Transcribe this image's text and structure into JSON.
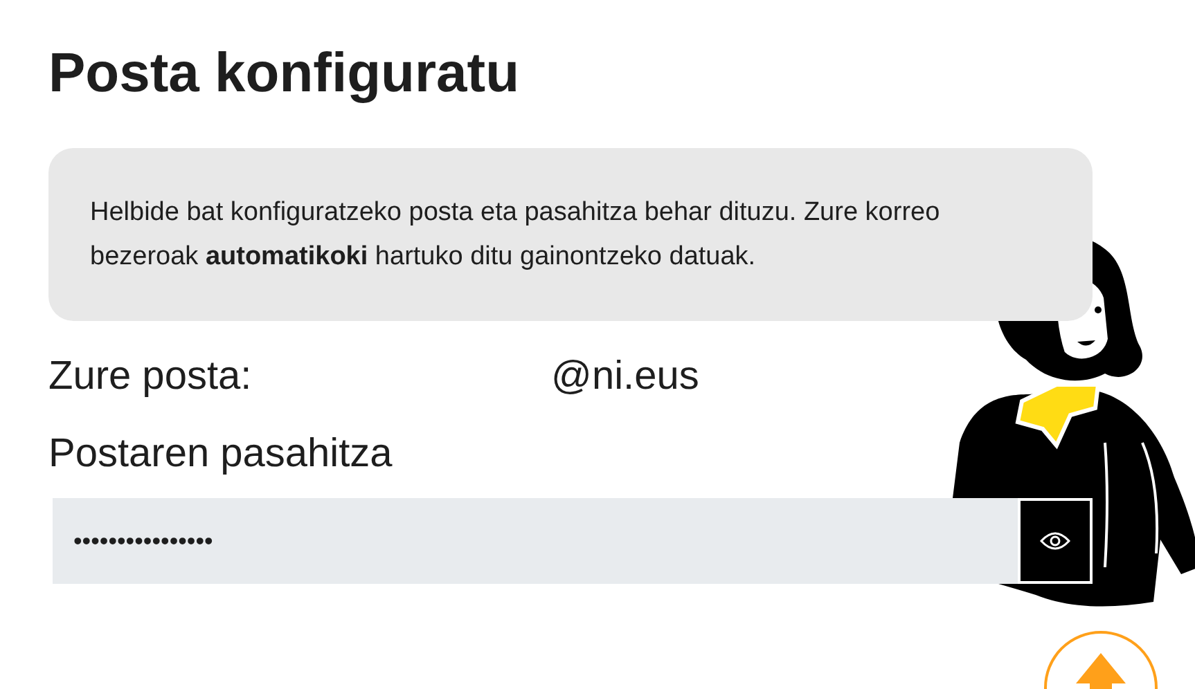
{
  "title": "Posta konfiguratu",
  "info": "Helbide bat konfiguratzeko posta eta pasahitza behar dituzu. Zure korreo bezeroak **automatikoki** hartuko ditu gainontzeko datuak.",
  "email": {
    "label": "Zure posta:",
    "domain": "@ni.eus"
  },
  "password": {
    "label": "Postaren pasahitza",
    "value": "••••••••••••••••"
  }
}
